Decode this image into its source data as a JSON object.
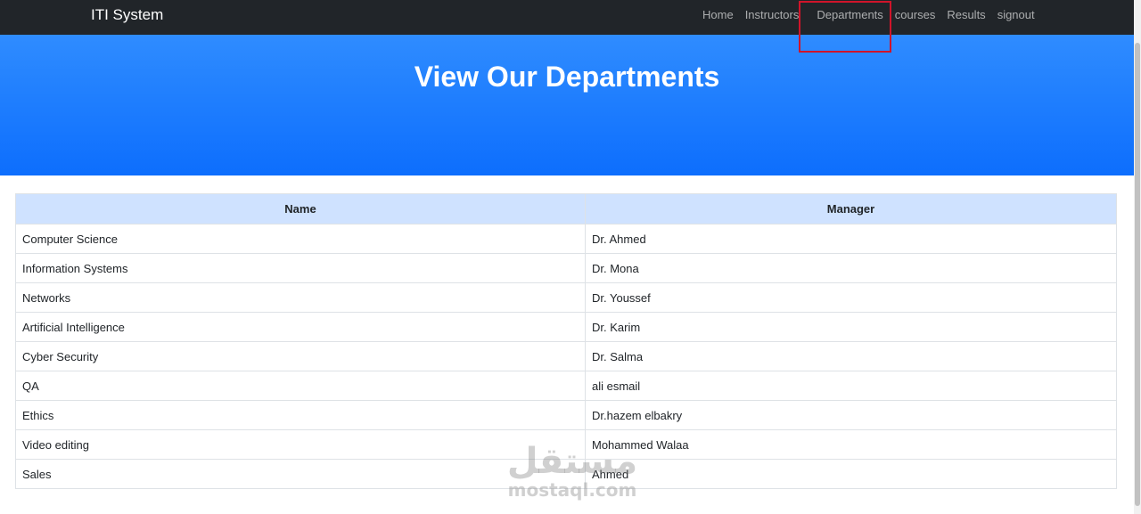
{
  "navbar": {
    "brand": "ITI System",
    "items": [
      {
        "label": "Home"
      },
      {
        "label": "Instructors"
      },
      {
        "label": "Departments"
      },
      {
        "label": "courses"
      },
      {
        "label": "Results"
      },
      {
        "label": "signout"
      }
    ],
    "highlighted_item": "Departments",
    "highlight_color": "#d0142a"
  },
  "hero": {
    "title": "View Our Departments",
    "color": "#0d6efd"
  },
  "table": {
    "headers": [
      "Name",
      "Manager"
    ],
    "header_bg": "#cfe2ff",
    "rows": [
      [
        "Computer Science",
        "Dr. Ahmed"
      ],
      [
        "Information Systems",
        "Dr. Mona"
      ],
      [
        "Networks",
        "Dr. Youssef"
      ],
      [
        "Artificial Intelligence",
        "Dr. Karim"
      ],
      [
        "Cyber Security",
        "Dr. Salma"
      ],
      [
        "QA",
        "ali esmail"
      ],
      [
        "Ethics",
        "Dr.hazem elbakry"
      ],
      [
        "Video editing",
        "Mohammed Walaa"
      ],
      [
        "Sales",
        "Ahmed"
      ]
    ]
  },
  "watermark": {
    "logo": "مستقل",
    "text": "mostaql.com"
  }
}
